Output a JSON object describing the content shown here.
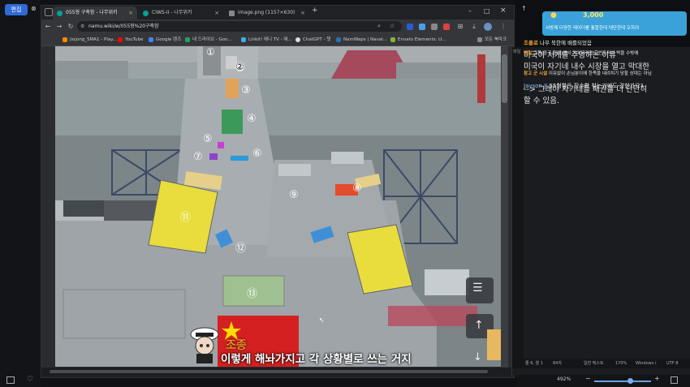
{
  "left_panel": {
    "edit_label": "편집"
  },
  "browser": {
    "tabs": [
      {
        "label": "055형 구축함 - 나무위키",
        "active": true
      },
      {
        "label": "CIWS-II - 나무위키",
        "active": false
      },
      {
        "label": "image.png (1157×630)",
        "active": false
      }
    ],
    "new_tab": "+",
    "url": "namu.wiki/w/055형%20구축함",
    "bookmarks": [
      {
        "label": "jiojong_SMA1 - Play...",
        "color": "#ff8a00"
      },
      {
        "label": "YouTube",
        "color": "#ff0000"
      },
      {
        "label": "Google 렌즈",
        "color": "#4285f4"
      },
      {
        "label": "내 드라이브 - Goo...",
        "color": "#1fa463"
      },
      {
        "label": "Linkit! 애니 TV - 애...",
        "color": "#3ab0e8"
      },
      {
        "label": "ChatGPT - 챗",
        "color": "#dddddd"
      },
      {
        "label": "NamWaps | Naval...",
        "color": "#2c6db5"
      },
      {
        "label": "Envato Elements: U...",
        "color": "#82b541"
      },
      {
        "label": "모든 북마크",
        "color": "#888888"
      }
    ]
  },
  "photo": {
    "labels": [
      "①",
      "②",
      "③",
      "④",
      "⑤",
      "⑥",
      "⑦",
      "⑧",
      "⑨",
      "⑪",
      "⑫",
      "⑬"
    ],
    "subtitle_speaker": "조종",
    "subtitle_text": "이렇게 해놔가지고 각 상황별로 쓰는 거지"
  },
  "chat": {
    "donation_amount": "3,000",
    "donation_msg": "서방제 다양한 레이더를 통합한데 대단한데 오히려",
    "lines": [
      {
        "name": "조롱로",
        "text": "나무 북한에 배를되었음"
      },
      {
        "name": "병일",
        "text": "그쪽(중국 항대)에서 기여도라면 한번도어서 박을 수밖에"
      },
      {
        "name": "참고 군 시설",
        "text": "이유없이 손님분이에 한족을 내려치기 당할 상대는 아님"
      },
      {
        "name": "Jayson JI",
        "text": "55형함은 장수함 찾는거예도 강한가요?"
      }
    ]
  },
  "notepad": {
    "line1": "미국이 서게를 주영하는 이유",
    "line2": "미국이 자기네 내수 시장을 열고 막대한",
    "line3": "--> 그래야 자기네들 패권을 더 단단히",
    "line4": "할 수 있음.",
    "status_pos": "줄 6, 열 1",
    "status_chars": "84자",
    "status_type": "일반 텍스트",
    "status_zoom": "170%",
    "status_eol": "Windows (",
    "status_enc": "UTF-8",
    "bottom_zoom": "492%"
  }
}
